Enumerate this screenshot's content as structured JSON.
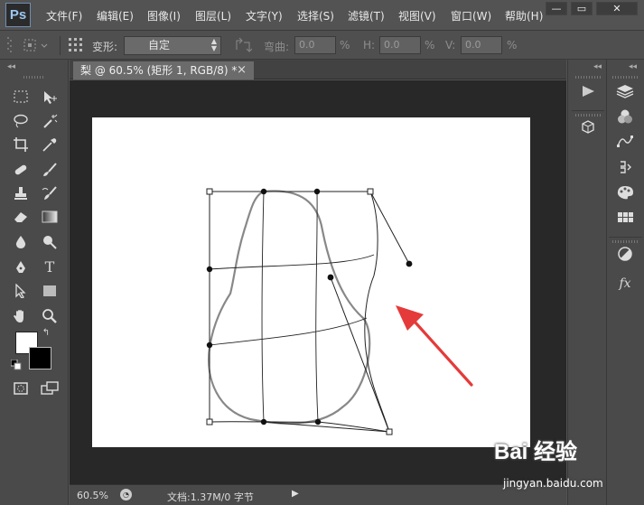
{
  "app": {
    "logo": "Ps",
    "menus": [
      "文件(F)",
      "编辑(E)",
      "图像(I)",
      "图层(L)",
      "文字(Y)",
      "选择(S)",
      "滤镜(T)",
      "视图(V)",
      "窗口(W)",
      "帮助(H)"
    ],
    "window_buttons": {
      "minimize": "—",
      "restore": "▭",
      "close": "✕"
    }
  },
  "options": {
    "warp_label": "变形:",
    "warp_value": "自定",
    "bend_label": "弯曲:",
    "bend_value": "0.0",
    "h_label": "H:",
    "h_value": "0.0",
    "v_label": "V:",
    "v_value": "0.0",
    "percent": "%"
  },
  "document": {
    "tab_title": "梨 @ 60.5% (矩形 1, RGB/8) *",
    "close": "×"
  },
  "status": {
    "zoom": "60.5%",
    "doc_info": "文档:1.37M/0 字节"
  },
  "colors": {
    "foreground": "#ffffff",
    "background": "#000000",
    "annotation_arrow": "#e53a3a"
  },
  "tools": {
    "type_tool_glyph": "T",
    "icons": [
      "marquee-icon",
      "move-icon",
      "lasso-icon",
      "magic-wand-icon",
      "crop-icon",
      "eyedropper-icon",
      "healing-brush-icon",
      "brush-icon",
      "clone-stamp-icon",
      "history-brush-icon",
      "eraser-icon",
      "gradient-icon",
      "blur-icon",
      "dodge-icon",
      "pen-icon",
      "type-icon",
      "path-selection-icon",
      "rectangle-icon",
      "hand-icon",
      "zoom-icon",
      "quick-mask-icon",
      "screen-mode-icon"
    ]
  },
  "panels": {
    "fx_label": "fx"
  },
  "watermark": {
    "line1": "Bai 经验",
    "line2": "jingyan.baidu.com"
  }
}
